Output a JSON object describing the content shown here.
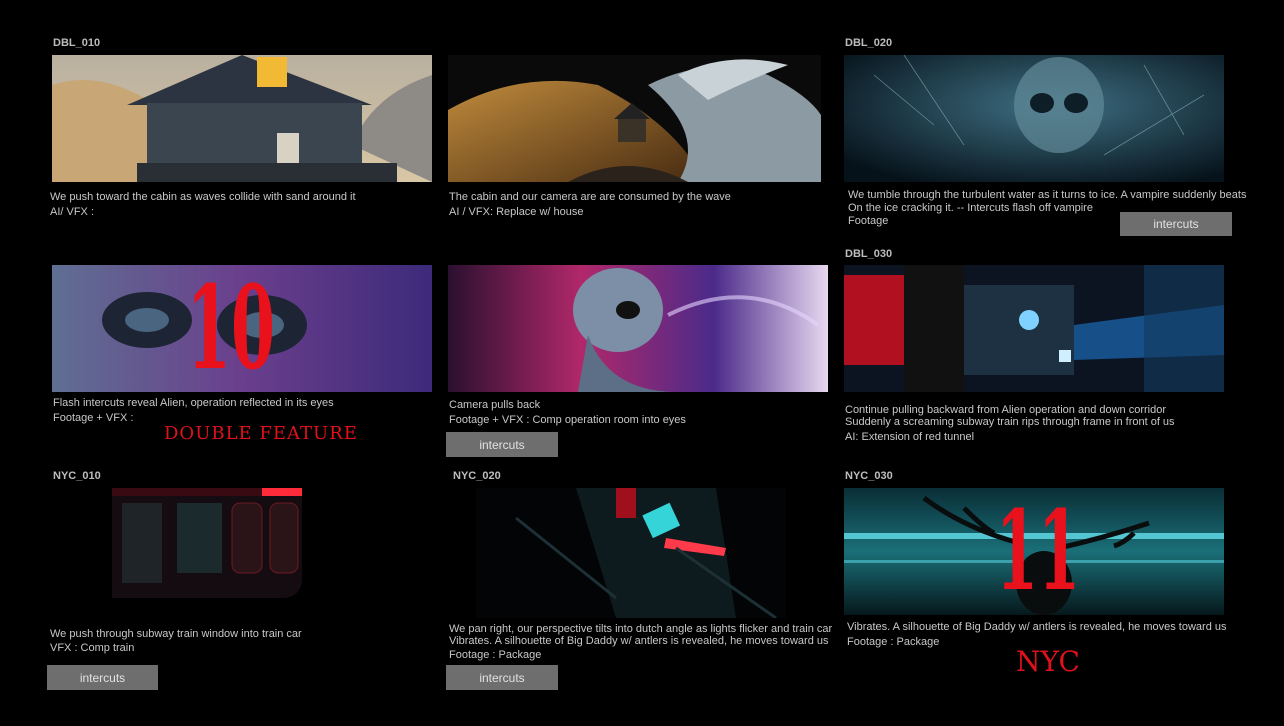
{
  "shots": {
    "dbl_010": {
      "id": "DBL_010",
      "desc_1": "We push toward the cabin as waves collide with sand around it",
      "note": "AI/ VFX :"
    },
    "dbl_010b": {
      "desc_1": "The cabin and our camera are are consumed by the wave",
      "note": "AI / VFX: Replace w/ house"
    },
    "dbl_020": {
      "id": "DBL_020",
      "desc_1": "We tumble through the turbulent water as it turns to ice. A vampire suddenly beats",
      "desc_2": "On the ice cracking it. -- Intercuts flash off vampire",
      "note": "Footage",
      "button": "intercuts"
    },
    "alien_a": {
      "overlay_number": "10",
      "desc_1": "Flash intercuts reveal Alien, operation reflected in its eyes",
      "note": "Footage + VFX :",
      "logo": "DOUBLE FEATURE"
    },
    "alien_b": {
      "desc_1": "Camera pulls back",
      "note": "Footage + VFX : Comp operation room into eyes",
      "button": "intercuts"
    },
    "dbl_030": {
      "id": "DBL_030",
      "desc_1": "Continue pulling backward from Alien operation and down corridor",
      "desc_2": "Suddenly a screaming subway train rips through frame in front of us",
      "note": "AI: Extension of red tunnel"
    },
    "nyc_010": {
      "id": "NYC_010",
      "desc_1": "We push through subway train window into train car",
      "note": "VFX : Comp train",
      "button": "intercuts"
    },
    "nyc_020": {
      "id": "NYC_020",
      "desc_1": "We pan right, our perspective tilts into dutch angle as lights flicker and train car",
      "desc_2": "Vibrates. A silhouette of Big Daddy w/ antlers is revealed, he moves toward us",
      "note": "Footage : Package",
      "button": "intercuts"
    },
    "nyc_030": {
      "id": "NYC_030",
      "overlay_number": "11",
      "desc_1": "Vibrates. A silhouette of Big Daddy w/ antlers is revealed, he moves toward us",
      "note": "Footage : Package",
      "logo": "NYC"
    }
  },
  "colors": {
    "background": "#000000",
    "button": "#6e6e6e",
    "accent_red": "#e0111b"
  }
}
